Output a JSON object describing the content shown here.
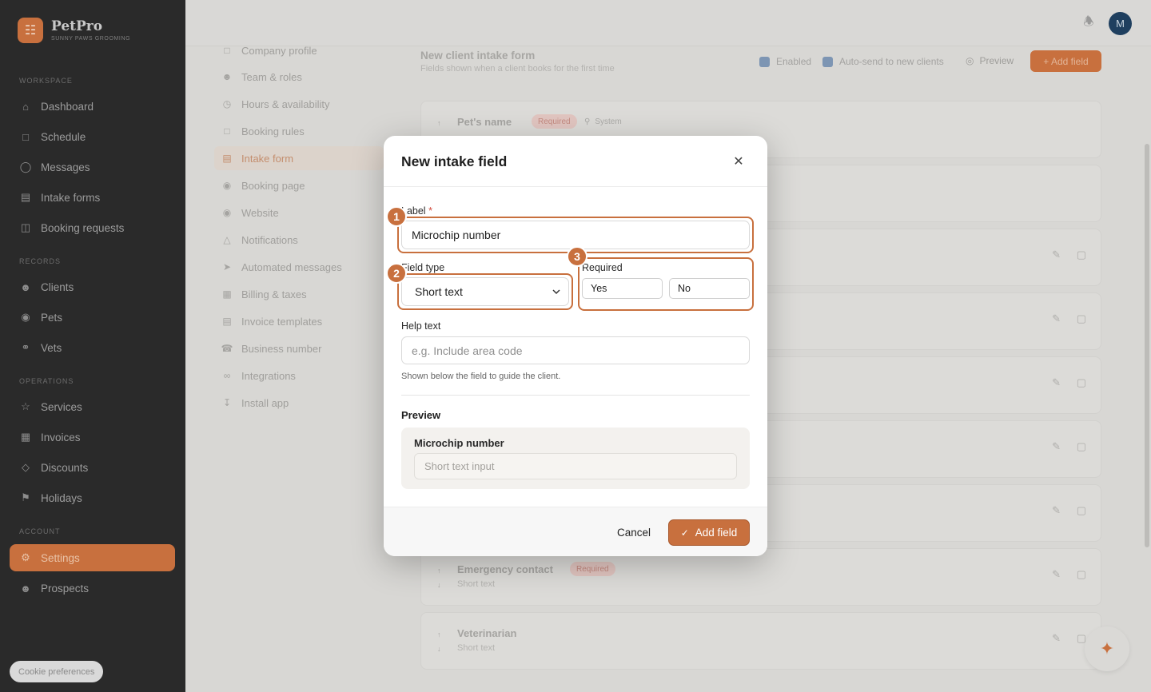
{
  "brand": {
    "name": "PetPro",
    "subtitle": "SUNNY PAWS GROOMING"
  },
  "sidebar": {
    "sections": {
      "workspace": "WORKSPACE",
      "records": "RECORDS",
      "operations": "OPERATIONS",
      "account": "ACCOUNT"
    },
    "items": [
      {
        "label": "Dashboard",
        "icon": "home-icon"
      },
      {
        "label": "Schedule",
        "icon": "calendar-icon"
      },
      {
        "label": "Messages",
        "icon": "chat-icon"
      },
      {
        "label": "Intake forms",
        "icon": "document-icon"
      },
      {
        "label": "Booking requests",
        "icon": "inbox-icon"
      },
      {
        "label": "Clients",
        "icon": "users-icon"
      },
      {
        "label": "Pets",
        "icon": "paw-icon"
      },
      {
        "label": "Vets",
        "icon": "stethoscope-icon"
      },
      {
        "label": "Services",
        "icon": "star-icon"
      },
      {
        "label": "Invoices",
        "icon": "invoice-icon"
      },
      {
        "label": "Discounts",
        "icon": "tag-icon"
      },
      {
        "label": "Holidays",
        "icon": "flag-icon"
      },
      {
        "label": "Settings",
        "icon": "gear-icon",
        "active": true
      },
      {
        "label": "Prospects",
        "icon": "users-icon"
      }
    ],
    "cookie_button": "Cookie preferences"
  },
  "topbar": {
    "avatar_initial": "M"
  },
  "settings_nav": {
    "items": [
      {
        "label": "Company profile"
      },
      {
        "label": "Team & roles"
      },
      {
        "label": "Hours & availability"
      },
      {
        "label": "Booking rules"
      },
      {
        "label": "Intake form",
        "active": true
      },
      {
        "label": "Booking page"
      },
      {
        "label": "Website"
      },
      {
        "label": "Notifications"
      },
      {
        "label": "Automated messages"
      },
      {
        "label": "Billing & taxes"
      },
      {
        "label": "Invoice templates"
      },
      {
        "label": "Business number"
      },
      {
        "label": "Integrations"
      },
      {
        "label": "Install app"
      }
    ]
  },
  "content": {
    "title": "New client intake form",
    "subtitle": "Fields shown when a client books for the first time",
    "enabled_label": "Enabled",
    "autosend_label": "Auto-send to new clients",
    "preview_label": "Preview",
    "add_field_label": "+ Add field",
    "fields": [
      {
        "name": "Pet's name",
        "type": "Short text",
        "badge": "Required",
        "system": "System"
      },
      {
        "name": "Emergency contact",
        "type": "Short text",
        "badge": "Required"
      },
      {
        "name": "Veterinarian",
        "type": "Short text"
      }
    ]
  },
  "modal": {
    "title": "New intake field",
    "label_field": {
      "label": "Label",
      "required_mark": "*",
      "value": "Microchip number"
    },
    "field_type": {
      "label": "Field type",
      "value": "Short text"
    },
    "required": {
      "label": "Required",
      "yes": "Yes",
      "no": "No"
    },
    "help_text": {
      "label": "Help text",
      "placeholder": "e.g. Include area code",
      "hint": "Shown below the field to guide the client."
    },
    "preview": {
      "title": "Preview",
      "field_label": "Microchip number",
      "input_placeholder": "Short text input"
    },
    "cancel": "Cancel",
    "submit": "Add field",
    "markers": [
      "1",
      "2",
      "3"
    ]
  },
  "colors": {
    "accent": "#c8703e",
    "sidebar_bg": "#2a2a2a",
    "modal_bg": "#ffffff"
  }
}
